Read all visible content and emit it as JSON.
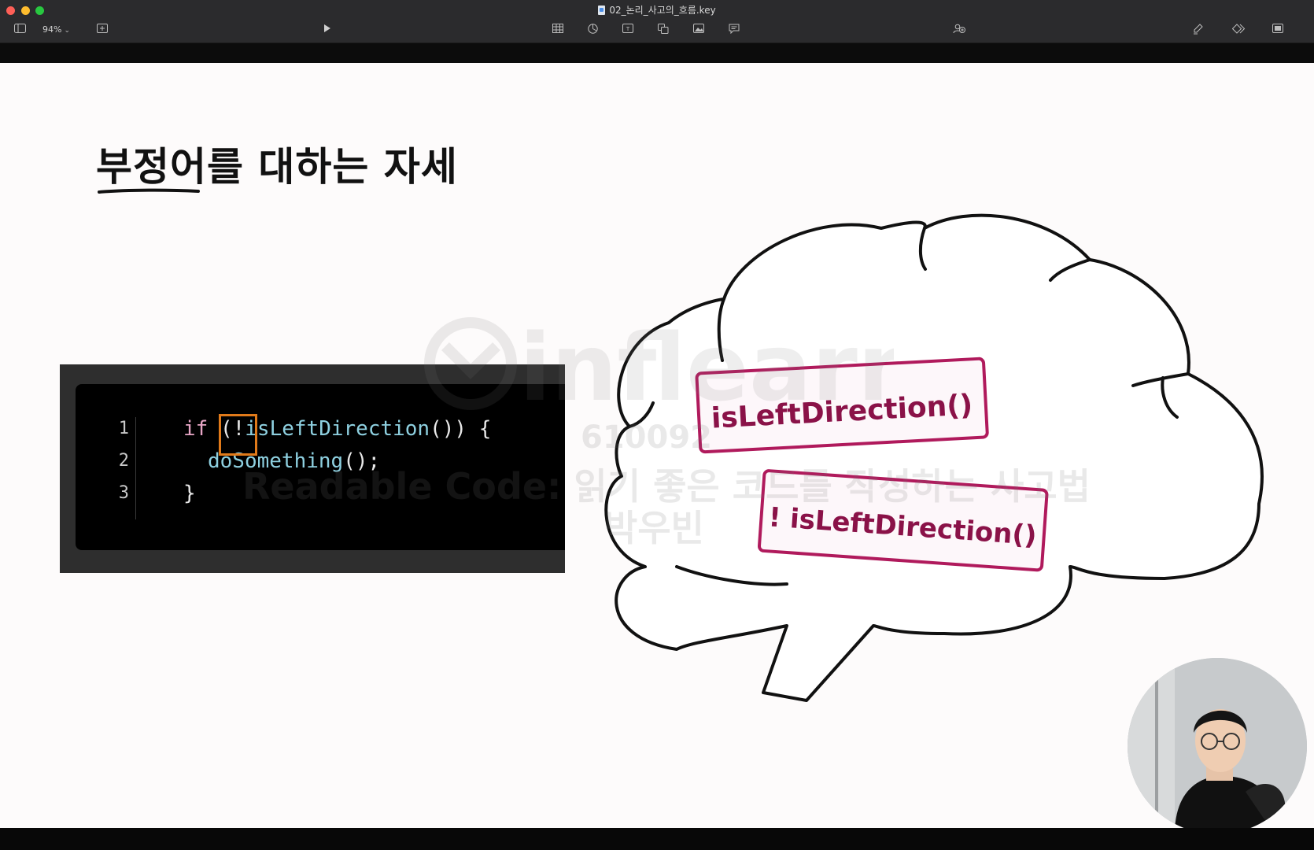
{
  "window": {
    "file_name": "02_논리_사고의_흐름.key"
  },
  "toolbar": {
    "zoom_value": "94%",
    "icons": [
      "sidebar-icon",
      "add-slide-icon",
      "play-icon",
      "table-icon",
      "chart-icon",
      "text-icon",
      "shape-icon",
      "media-icon",
      "comment-icon",
      "collaborate-icon",
      "format-brush-icon",
      "animate-icon",
      "document-icon"
    ]
  },
  "slide": {
    "title": "부정어를 대하는 자세",
    "code": {
      "line_numbers": [
        "1",
        "2",
        "3"
      ],
      "line1": {
        "kw": "if",
        "open": "(!",
        "fn": "isLeftDirection",
        "rest": "()) {"
      },
      "line2": {
        "fn": "doSomething",
        "rest": "();"
      },
      "line3": "}"
    },
    "bubble": {
      "tag1": "isLeftDirection()",
      "tag2": "! isLeftDirection()"
    }
  },
  "watermark": {
    "logo": "inflearn",
    "id": "610092",
    "course": "Readable Code: 읽기 좋은 코드를 작성하는 사고법",
    "author": "박우빈"
  },
  "colors": {
    "tag_accent": "#b01a5c",
    "highlight_box": "#e07a1a"
  }
}
